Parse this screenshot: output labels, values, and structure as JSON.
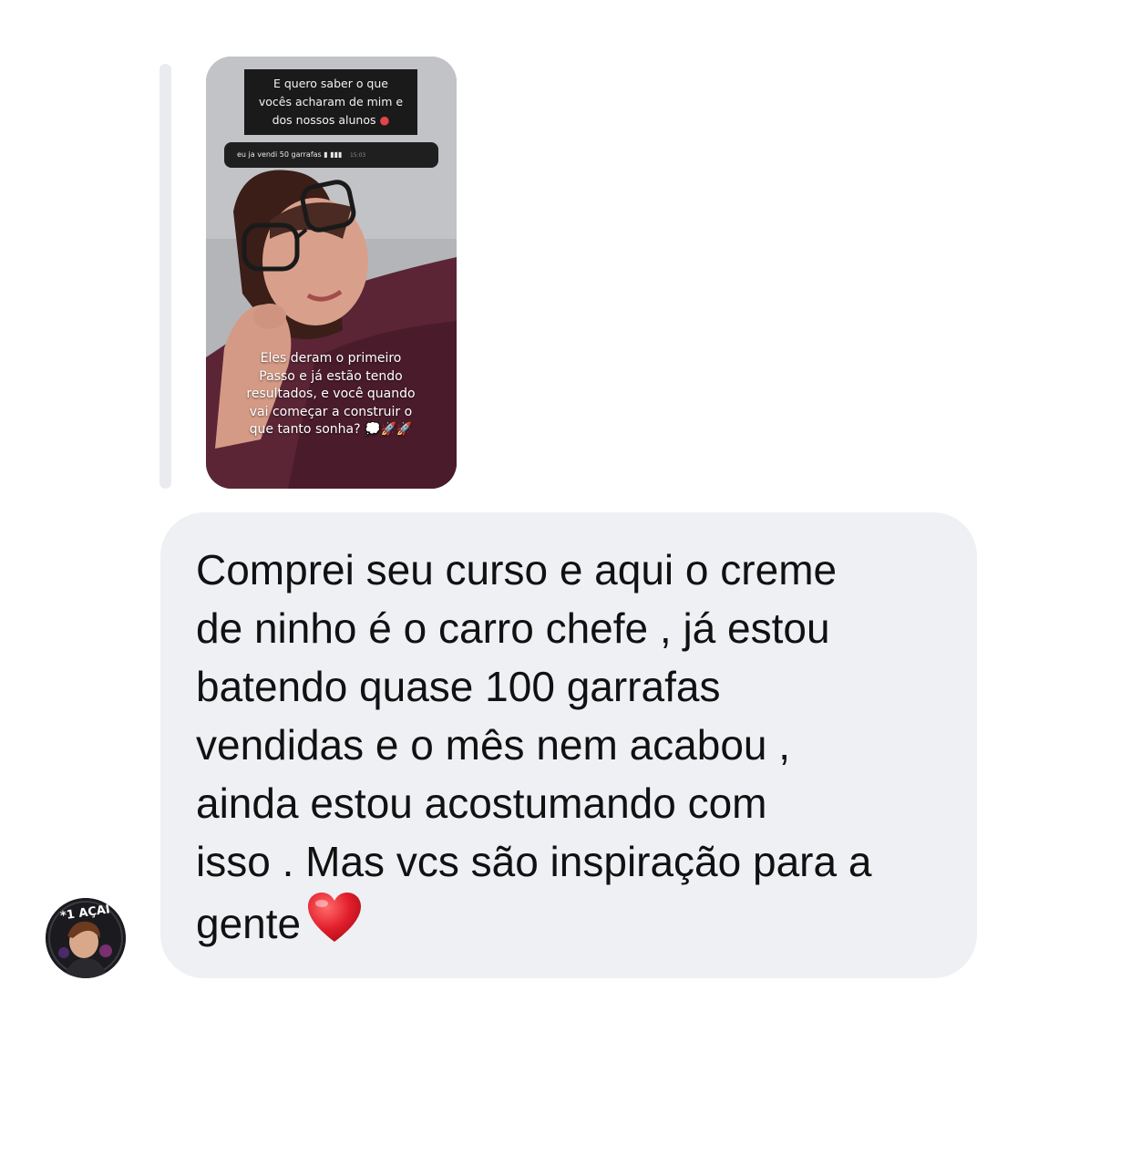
{
  "story": {
    "question_lines": [
      "E quero saber o que",
      "vocês acharam de mim e",
      "dos nossos alunos"
    ],
    "question_emoji": "heart-eyes-emoji",
    "reply_text": "eu ja vendi 50 garrafas",
    "reply_time": "15:03",
    "caption_lines": [
      "Eles deram o primeiro",
      "Passo e já estão tendo",
      "resultados, e você quando",
      "vai começar a construir o",
      "que tanto sonha?"
    ]
  },
  "message": {
    "lines": [
      "Comprei seu curso e aqui o creme",
      "de ninho é o carro chefe , já estou",
      "batendo quase 100 garrafas",
      "vendidas e o mês nem acabou ,",
      "ainda estou acostumando com",
      "isso . Mas vcs são inspiração para a",
      "gente"
    ],
    "emoji": "red-heart-icon"
  },
  "avatar": {
    "badge_text": "*1 AÇAÍ"
  },
  "colors": {
    "bubble": "#eff0f4",
    "reply_bar": "#e9ebef",
    "text": "#111111",
    "heart": "#e11d2a"
  }
}
